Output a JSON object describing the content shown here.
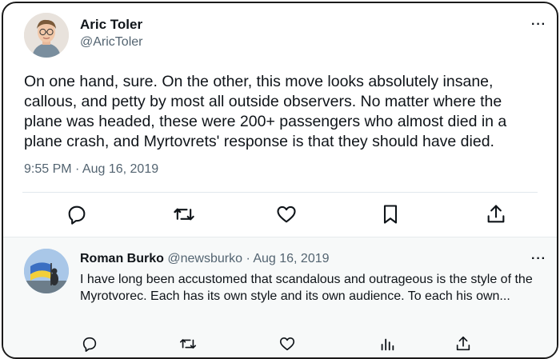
{
  "main_tweet": {
    "author_name": "Aric Toler",
    "author_handle": "@AricToler",
    "text": "On one hand, sure. On the other, this move looks absolutely insane, callous, and petty by most all outside observers. No matter where the plane was headed, these were 200+ passengers who almost died in a plane crash, and Myrtovrets' response is that they should have died.",
    "timestamp": "9:55 PM · Aug 16, 2019",
    "more_label": "···",
    "actions": [
      "reply-icon",
      "retweet-icon",
      "like-icon",
      "bookmark-icon",
      "share-icon"
    ]
  },
  "reply_tweet": {
    "author_name": "Roman Burko",
    "author_handle": "@newsburko",
    "meta_separator": "·",
    "date": "Aug 16, 2019",
    "text": "I have long been accustomed that scandalous and outrageous is the style of the Myrotvorec. Each has its own style and its own audience. To each his own...",
    "more_label": "···",
    "actions": [
      "reply-icon",
      "retweet-icon",
      "like-icon",
      "views-icon",
      "share-icon"
    ]
  },
  "colors": {
    "text_primary": "#0f1419",
    "text_secondary": "#536471",
    "reply_background": "#f7f9f9",
    "frame_border": "#1a1a1a"
  }
}
